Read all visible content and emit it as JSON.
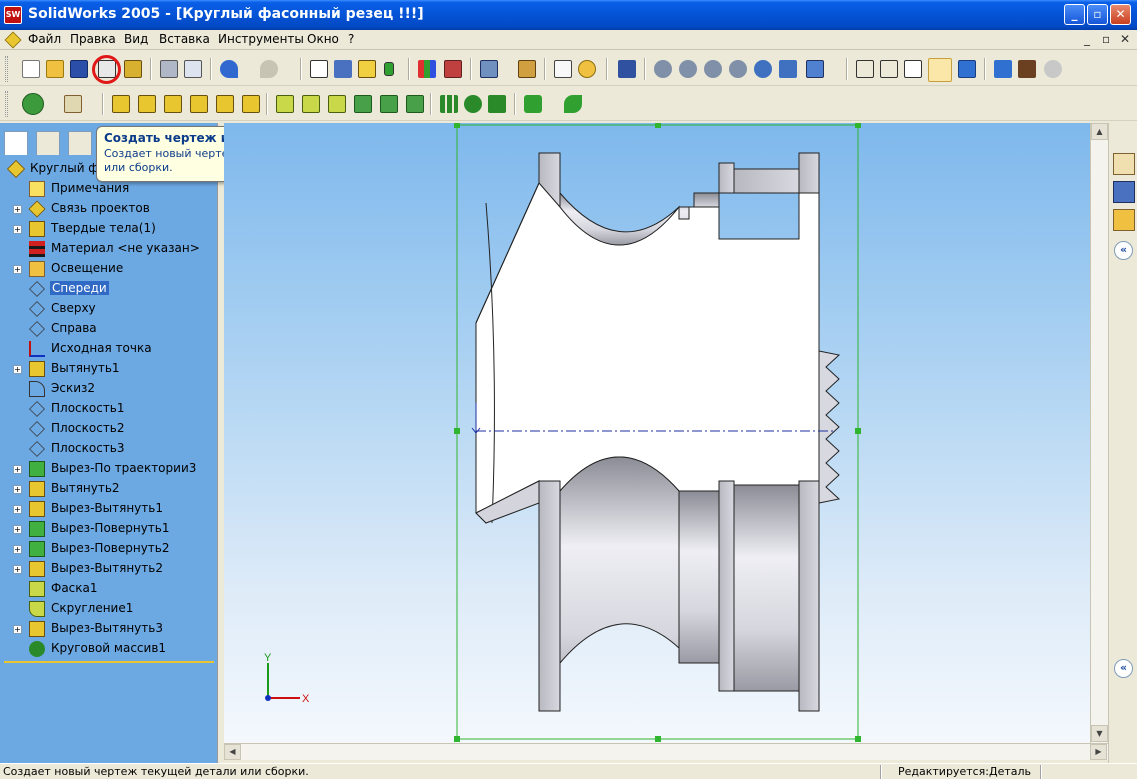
{
  "window": {
    "title": "SolidWorks 2005 - [Круглый фасонный резец !!!]",
    "app_icon_text": "SW",
    "controls": {
      "minimize": "_",
      "maximize": "▫",
      "close": "✕"
    }
  },
  "menu": {
    "items": [
      "Файл",
      "Правка",
      "Вид",
      "Вставка",
      "Инструменты",
      "Окно",
      "?"
    ],
    "mdi_controls": [
      "_",
      "▫",
      "✕"
    ]
  },
  "tooltip": {
    "title": "Создать чертеж из детали/сборки",
    "body": "Создает новый чертеж текущей детали или сборки."
  },
  "feature_tree": {
    "root": "Круглый фа",
    "items": [
      {
        "label": "Примечания",
        "icon": "annotations-icon",
        "expandable": false
      },
      {
        "label": "Связь проектов",
        "icon": "design-binder-icon",
        "expandable": true
      },
      {
        "label": "Твердые тела(1)",
        "icon": "solid-bodies-icon",
        "expandable": true
      },
      {
        "label": "Материал <не указан>",
        "icon": "material-icon",
        "expandable": false
      },
      {
        "label": "Освещение",
        "icon": "lighting-icon",
        "expandable": true
      },
      {
        "label": "Спереди",
        "icon": "plane-icon",
        "expandable": false,
        "selected": true
      },
      {
        "label": "Сверху",
        "icon": "plane-icon",
        "expandable": false
      },
      {
        "label": "Справа",
        "icon": "plane-icon",
        "expandable": false
      },
      {
        "label": "Исходная точка",
        "icon": "origin-icon",
        "expandable": false
      },
      {
        "label": "Вытянуть1",
        "icon": "extrude-icon",
        "expandable": true
      },
      {
        "label": "Эскиз2",
        "icon": "sketch-icon",
        "expandable": false
      },
      {
        "label": "Плоскость1",
        "icon": "plane-icon",
        "expandable": false
      },
      {
        "label": "Плоскость2",
        "icon": "plane-icon",
        "expandable": false
      },
      {
        "label": "Плоскость3",
        "icon": "plane-icon",
        "expandable": false
      },
      {
        "label": "Вырез-По траектории3",
        "icon": "sweep-cut-icon",
        "expandable": true
      },
      {
        "label": "Вытянуть2",
        "icon": "extrude-icon",
        "expandable": true
      },
      {
        "label": "Вырез-Вытянуть1",
        "icon": "extrude-cut-icon",
        "expandable": true
      },
      {
        "label": "Вырез-Повернуть1",
        "icon": "revolve-cut-icon",
        "expandable": true
      },
      {
        "label": "Вырез-Повернуть2",
        "icon": "revolve-cut-icon",
        "expandable": true
      },
      {
        "label": "Вырез-Вытянуть2",
        "icon": "extrude-cut-icon",
        "expandable": true
      },
      {
        "label": "Фаска1",
        "icon": "chamfer-icon",
        "expandable": false
      },
      {
        "label": "Скругление1",
        "icon": "fillet-icon",
        "expandable": false
      },
      {
        "label": "Вырез-Вытянуть3",
        "icon": "extrude-cut-icon",
        "expandable": true
      },
      {
        "label": "Круговой массив1",
        "icon": "circular-pattern-icon",
        "expandable": false
      }
    ]
  },
  "viewport": {
    "triad": {
      "x_label": "X",
      "y_label": "Y"
    }
  },
  "status": {
    "left": "Создает новый чертеж текущей детали или сборки.",
    "right": "Редактируется:Деталь"
  },
  "colors": {
    "title_bar": "#0453D6",
    "feature_tree_bg": "#6CA8E2",
    "selection": "#316AC5",
    "bounding_box": "#2FB52F",
    "highlight_circle": "#E01818"
  }
}
